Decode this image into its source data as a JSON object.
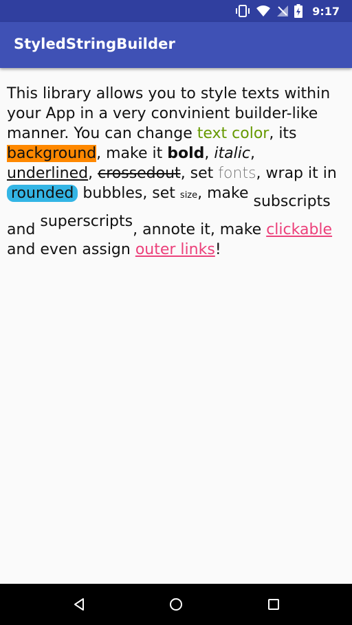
{
  "status_bar": {
    "time": "9:17",
    "icons": [
      "vibrate-icon",
      "wifi-icon",
      "signal-icon",
      "battery-icon"
    ]
  },
  "app_bar": {
    "title": "StyledStringBuilder",
    "color": "#3f51b5",
    "status_color": "#303f9f"
  },
  "content": {
    "t1": "This library allows you to style texts within your App in a very convinient builder-like manner. You can change ",
    "text_color": "text color",
    "t2": ", its ",
    "background": "background",
    "t3": ", make it ",
    "bold": "bold",
    "t4": ", ",
    "italic": "italic",
    "t5": ", ",
    "underlined": "underlined",
    "t6": ", ",
    "crossedout": "crossedout",
    "t7": ", set ",
    "fonts": "fonts",
    "t8": ", wrap it in ",
    "rounded": "rounded",
    "t9": " bubbles, set ",
    "size": "size",
    "t10": ", make ",
    "subscripts": "subscripts",
    "t11": " and ",
    "superscripts": "superscripts",
    "t12": ", annote it, make ",
    "clickable": "clickable",
    "t13": " and even assign ",
    "outer_links": "outer links",
    "t14": "!",
    "colors": {
      "text_color": "#669900",
      "background": "#ff8800",
      "bubble": "#33b5e5",
      "link": "#ec407a"
    }
  },
  "nav_bar": {
    "buttons": [
      "back-icon",
      "home-icon",
      "recents-icon"
    ]
  }
}
